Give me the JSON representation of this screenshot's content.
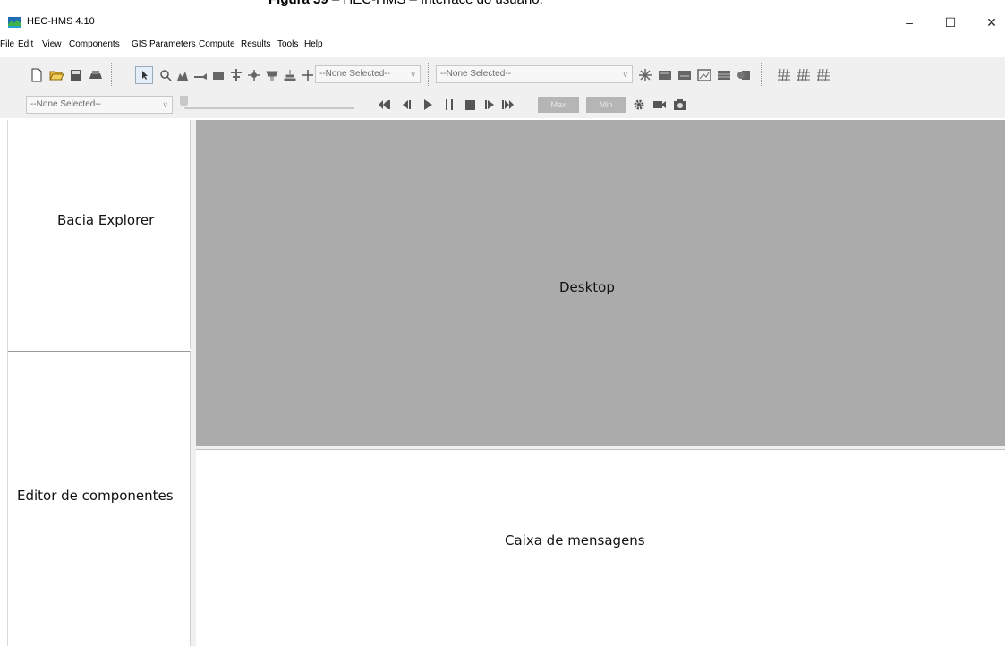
{
  "caption": {
    "bold": "Figura 39",
    "rest": " – HEC-HMS – Interface do usuário."
  },
  "window": {
    "title": "HEC-HMS 4.10",
    "minimize": "–",
    "maximize": "☐",
    "close": "✕"
  },
  "menu": [
    "File",
    "Edit",
    "View",
    "Components",
    "GIS",
    "Parameters",
    "Compute",
    "Results",
    "Tools",
    "Help"
  ],
  "toolbar": {
    "combo1": "--None Selected--",
    "combo2": "--None Selected--",
    "combo3": "--None Selected--",
    "max_label": "Max",
    "min_label": "Min"
  },
  "panes": {
    "explorer": "Bacia Explorer",
    "editor": "Editor de componentes",
    "desktop": "Desktop",
    "messages": "Caixa de mensagens"
  },
  "colors": {
    "desktop_bg": "#ababab",
    "toolbar_bg": "#f0f0f0"
  }
}
